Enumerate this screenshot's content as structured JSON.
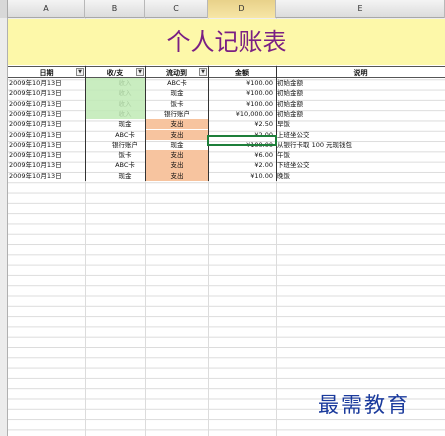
{
  "columns": [
    "A",
    "B",
    "C",
    "D",
    "E"
  ],
  "title": "个人记账表",
  "headers": {
    "date": "日期",
    "income_expense": "收/支",
    "flow": "流动到",
    "amount": "金额",
    "note": "说明"
  },
  "rows": [
    {
      "date": "2009年10月13日",
      "type": "收入",
      "flow": "ABC卡",
      "amount": "¥100.00",
      "note": "初始金额"
    },
    {
      "date": "2009年10月13日",
      "type": "收入",
      "flow": "现金",
      "amount": "¥100.00",
      "note": "初始金额"
    },
    {
      "date": "2009年10月13日",
      "type": "收入",
      "flow": "饭卡",
      "amount": "¥100.00",
      "note": "初始金额"
    },
    {
      "date": "2009年10月13日",
      "type": "收入",
      "flow": "银行账户",
      "amount": "¥10,000.00",
      "note": "初始金额"
    },
    {
      "date": "2009年10月13日",
      "type": "现金",
      "flow": "支出",
      "amount": "¥2.50",
      "note": "早饭"
    },
    {
      "date": "2009年10月13日",
      "type": "ABC卡",
      "flow": "支出",
      "amount": "¥2.00",
      "note": "上班坐公交"
    },
    {
      "date": "2009年10月13日",
      "type": "银行账户",
      "flow": "现金",
      "amount": "¥100.00",
      "note": "从银行卡取 100 元现钱包"
    },
    {
      "date": "2009年10月13日",
      "type": "饭卡",
      "flow": "支出",
      "amount": "¥6.00",
      "note": "午饭"
    },
    {
      "date": "2009年10月13日",
      "type": "ABC卡",
      "flow": "支出",
      "amount": "¥2.00",
      "note": "下班坐公交"
    },
    {
      "date": "2009年10月13日",
      "type": "现金",
      "flow": "支出",
      "amount": "¥10.00",
      "note": "晚饭"
    }
  ],
  "watermark": "最需教育",
  "colors": {
    "title_band": "#fdf8a9",
    "title_text": "#7a1f84",
    "income_cell": "#bfeab5",
    "expense_cell": "#f7c49f",
    "watermark": "#1a3a9c"
  }
}
